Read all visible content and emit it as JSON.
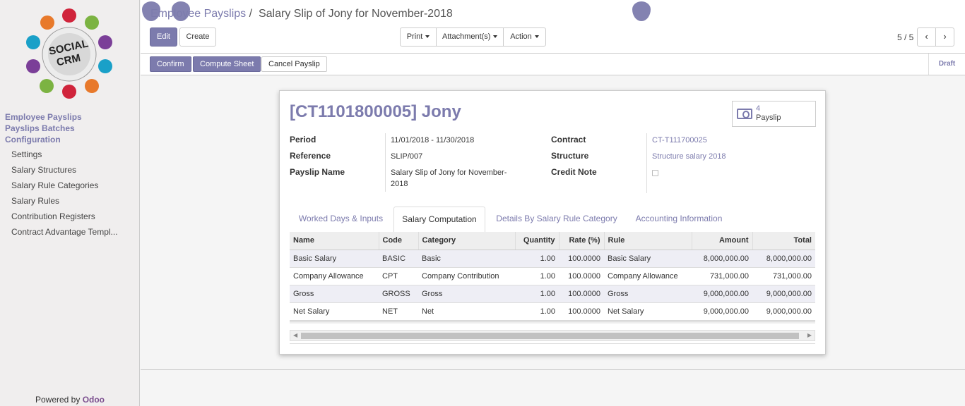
{
  "sidebar": {
    "logo_text": "SOCIAL CRM",
    "sections": [
      "Employee Payslips",
      "Payslips Batches",
      "Configuration"
    ],
    "config_items": [
      "Settings",
      "Salary Structures",
      "Salary Rule Categories",
      "Salary Rules",
      "Contribution Registers",
      "Contract Advantage Templ..."
    ],
    "powered_by": "Powered by",
    "powered_brand": "Odoo"
  },
  "breadcrumb": {
    "parent": "Employee Payslips",
    "separator": "/",
    "current": "Salary Slip of Jony for November-2018"
  },
  "toolbar": {
    "edit": "Edit",
    "create": "Create",
    "print": "Print",
    "attachments": "Attachment(s)",
    "action": "Action"
  },
  "pager": {
    "value": "5 / 5"
  },
  "statusbar": {
    "confirm": "Confirm",
    "compute": "Compute Sheet",
    "cancel": "Cancel Payslip",
    "state": "Draft"
  },
  "form": {
    "title": "[CT1101800005] Jony",
    "smart_button": {
      "count": "4",
      "label": "Payslip"
    },
    "left": {
      "period_label": "Period",
      "period": "11/01/2018 - 11/30/2018",
      "reference_label": "Reference",
      "reference": "SLIP/007",
      "name_label": "Payslip Name",
      "name_line1": "Salary Slip of Jony for November-",
      "name_line2": "2018"
    },
    "right": {
      "contract_label": "Contract",
      "contract": "CT-T111700025",
      "structure_label": "Structure",
      "structure": "Structure salary 2018",
      "credit_label": "Credit Note"
    },
    "tabs": [
      "Worked Days & Inputs",
      "Salary Computation",
      "Details By Salary Rule Category",
      "Accounting Information"
    ],
    "table": {
      "headers": [
        "Name",
        "Code",
        "Category",
        "Quantity",
        "Rate (%)",
        "Rule",
        "Amount",
        "Total"
      ],
      "rows": [
        [
          "Basic Salary",
          "BASIC",
          "Basic",
          "1.00",
          "100.0000",
          "Basic Salary",
          "8,000,000.00",
          "8,000,000.00"
        ],
        [
          "Company Allowance",
          "CPT",
          "Company Contribution",
          "1.00",
          "100.0000",
          "Company Allowance",
          "731,000.00",
          "731,000.00"
        ],
        [
          "Gross",
          "GROSS",
          "Gross",
          "1.00",
          "100.0000",
          "Gross",
          "9,000,000.00",
          "9,000,000.00"
        ],
        [
          "Net Salary",
          "NET",
          "Net",
          "1.00",
          "100.0000",
          "Net Salary",
          "9,000,000.00",
          "9,000,000.00"
        ]
      ]
    }
  },
  "colors": {
    "accent": "#7c7bad",
    "brand": "#7c4f8f"
  }
}
